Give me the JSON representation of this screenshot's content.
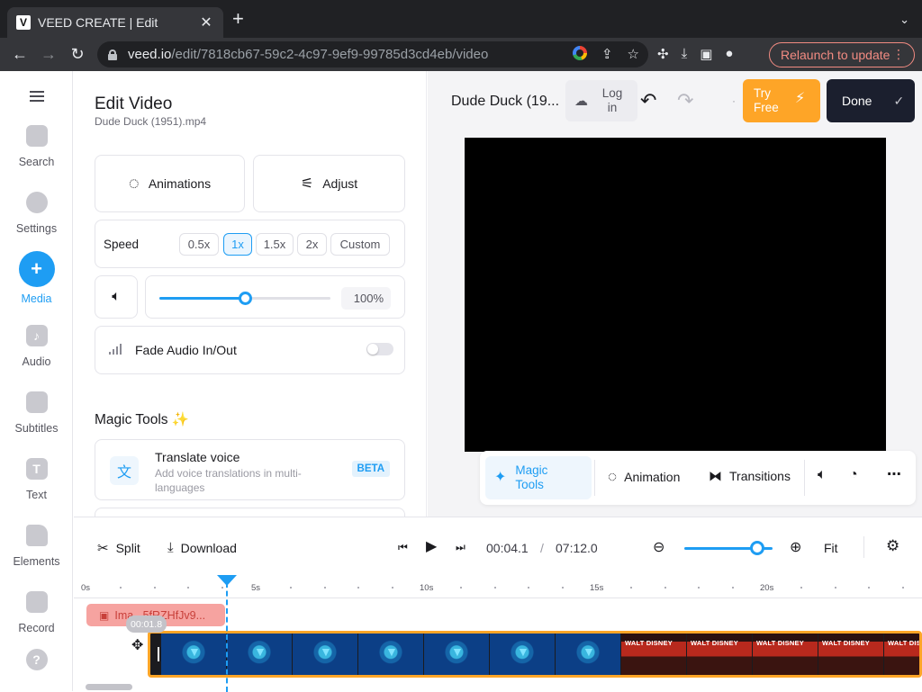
{
  "browser": {
    "tab_title": "VEED CREATE | Edit",
    "tab_favicon": "V",
    "url_host": "veed.io",
    "url_path": "/edit/7818cb67-59c2-4c97-9ef9-99785d3cd4eb/video",
    "relaunch_label": "Relaunch to update"
  },
  "rail": {
    "items": [
      {
        "label": "Search",
        "icon": "search-icon"
      },
      {
        "label": "Settings",
        "icon": "settings-icon"
      },
      {
        "label": "Media",
        "icon": "plus-icon",
        "glyph": "+"
      },
      {
        "label": "Audio",
        "icon": "music-note-icon",
        "glyph": "♪"
      },
      {
        "label": "Subtitles",
        "icon": "subtitles-icon"
      },
      {
        "label": "Text",
        "icon": "text-icon",
        "glyph": "T"
      },
      {
        "label": "Elements",
        "icon": "elements-icon"
      },
      {
        "label": "Record",
        "icon": "camera-icon"
      }
    ]
  },
  "panel": {
    "title": "Edit Video",
    "subtitle": "Dude Duck (1951).mp4",
    "animations_label": "Animations",
    "adjust_label": "Adjust",
    "speed_label": "Speed",
    "speed_options": [
      "0.5x",
      "1x",
      "1.5x",
      "2x",
      "Custom"
    ],
    "speed_selected": "1x",
    "volume_value": "100%",
    "volume_level": 0.5,
    "fade_label": "Fade Audio In/Out",
    "magic_title": "Magic Tools ✨",
    "translate_title": "Translate voice",
    "translate_desc": "Add voice translations in multi-languages",
    "beta_label": "BETA"
  },
  "editor": {
    "project_title": "Dude Duck (19...",
    "login_label": "Log in",
    "try_free_label": "Try Free",
    "done_label": "Done",
    "toolbar": {
      "magic_tools": "Magic Tools",
      "animation": "Animation",
      "transitions": "Transitions"
    }
  },
  "timeline": {
    "split_label": "Split",
    "download_label": "Download",
    "current_time": "00:04.1",
    "time_separator": "/",
    "total_time": "07:12.0",
    "fit_label": "Fit",
    "ruler_labels": [
      "0s",
      "5s",
      "10s",
      "15s",
      "20s"
    ],
    "image_clip_label": "Ima...5fRZHfJv9...",
    "playhead_time": "00:01.8"
  },
  "colors": {
    "accent": "#1e9df3",
    "try_free": "#fea527",
    "done_bg": "#1b1f2e",
    "clip_border": "#fea527",
    "image_clip": "#f6a3a0"
  }
}
